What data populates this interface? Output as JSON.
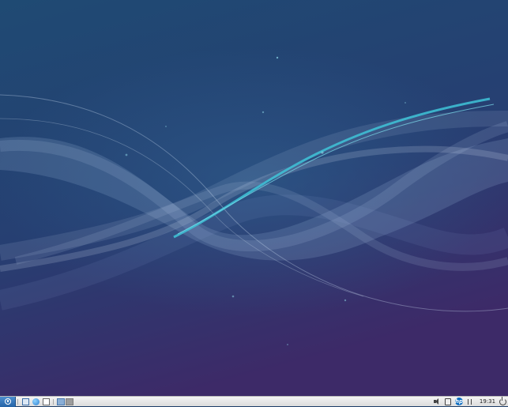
{
  "desktop": {
    "wallpaper_name": "blue-purple-wave-wallpaper"
  },
  "taskbar": {
    "start_icon": "lubuntu-logo-icon",
    "launchers": [
      {
        "name": "file-manager-icon"
      },
      {
        "name": "web-browser-icon"
      },
      {
        "name": "terminal-icon"
      }
    ],
    "desktops": [
      {
        "name": "desktop-1",
        "active": true
      },
      {
        "name": "desktop-2",
        "active": false
      }
    ],
    "tray": [
      {
        "name": "volume-icon"
      },
      {
        "name": "clipboard-icon"
      },
      {
        "name": "hp-printer-icon"
      },
      {
        "name": "network-icon"
      }
    ],
    "clock": "19:31",
    "power_icon": "power-icon"
  },
  "colors": {
    "wallpaper_top": "#1f4a73",
    "wallpaper_bottom": "#3d2a68",
    "wave_cyan": "#3fc4d8",
    "taskbar_bg": "#e6e6e6"
  }
}
